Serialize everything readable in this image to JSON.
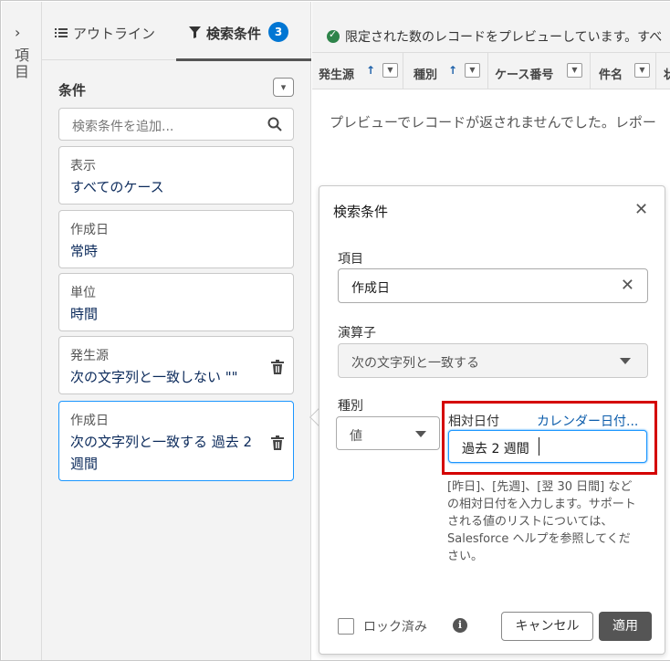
{
  "rail": {
    "toggle_glyph": "›",
    "label": "項目"
  },
  "tabs": {
    "outline": {
      "icon": "list-icon",
      "label": "アウトライン"
    },
    "filters": {
      "icon": "filter-icon",
      "label": "検索条件",
      "count": "3"
    }
  },
  "conditions": {
    "heading": "条件",
    "menu_glyph": "▾",
    "search_placeholder": "検索条件を追加...",
    "cards": [
      {
        "label": "表示",
        "value": "すべてのケース"
      },
      {
        "label": "作成日",
        "value": "常時"
      },
      {
        "label": "単位",
        "value": "時間"
      },
      {
        "label": "発生源",
        "value": "次の文字列と一致しない \"\""
      },
      {
        "label": "作成日",
        "value": "次の文字列と一致する 過去 2 週間"
      }
    ]
  },
  "banner": {
    "text": "限定された数のレコードをプレビューしています。すべ"
  },
  "columns": [
    {
      "label": "発生源",
      "sort": "↑"
    },
    {
      "label": "種別",
      "sort": "↑"
    },
    {
      "label": "ケース番号",
      "sort": ""
    },
    {
      "label": "件名",
      "sort": ""
    },
    {
      "label": "状",
      "sort": ""
    }
  ],
  "preview_empty_text": "プレビューでレコードが返されませんでした。レポー",
  "popover": {
    "title": "検索条件",
    "field_label": "項目",
    "field_value": "作成日",
    "operator_label": "演算子",
    "operator_value": "次の文字列と一致する",
    "type_label": "種別",
    "type_value": "値",
    "relative_label": "相対日付",
    "calendar_link": "カレンダー日付...",
    "relative_value": "過去 2 週間",
    "help_text": "[昨日]、[先週]、[翌 30 日間] などの相対日付を入力します。サポートされる値のリストについては、Salesforce ヘルプを参照してください。",
    "lock_label": "ロック済み",
    "info_glyph": "i",
    "cancel_label": "キャンセル",
    "apply_label": "適用"
  },
  "colors": {
    "accent": "#0176d3",
    "focus": "#1b96ff",
    "highlight": "#d40000",
    "success": "#2e844a",
    "link": "#0b5cab"
  }
}
